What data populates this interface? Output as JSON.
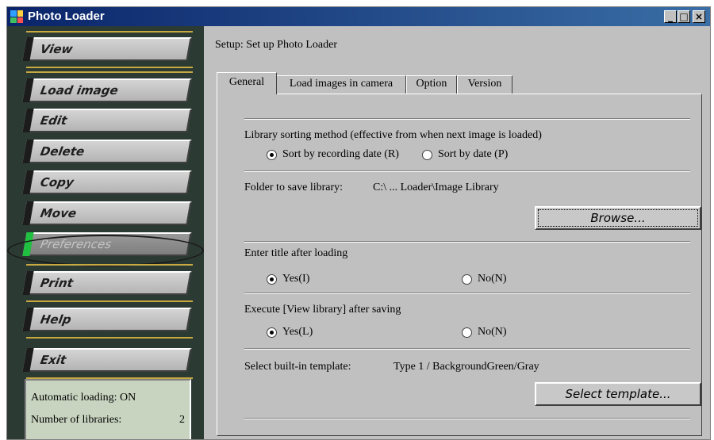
{
  "window": {
    "title": "Photo Loader",
    "min_glyph": "_",
    "max_glyph": "□",
    "close_glyph": "×"
  },
  "sidebar": {
    "buttons": [
      {
        "label": "View"
      },
      {
        "label": "Load image"
      },
      {
        "label": "Edit"
      },
      {
        "label": "Delete"
      },
      {
        "label": "Copy"
      },
      {
        "label": "Move"
      },
      {
        "label": "Preferences",
        "state": "selected"
      },
      {
        "label": "Print"
      },
      {
        "label": "Help"
      },
      {
        "label": "Exit"
      }
    ],
    "status": {
      "auto_loading": "Automatic loading:  ON",
      "libraries_label": "Number of libraries:",
      "libraries_value": "2"
    }
  },
  "content": {
    "header": "Setup: Set up Photo Loader",
    "tabs": [
      {
        "label": "General",
        "active": true
      },
      {
        "label": "Load images in camera"
      },
      {
        "label": "Option"
      },
      {
        "label": "Version"
      }
    ],
    "sorting": {
      "label": "Library sorting method (effective from when next image is loaded)",
      "opt1": "Sort by recording date (R)",
      "opt2": "Sort by date (P)",
      "selected": "opt1"
    },
    "folder": {
      "label": "Folder to save library:",
      "value": "C:\\ ... Loader\\Image Library",
      "browse_label": "Browse..."
    },
    "enter_title": {
      "label": "Enter title after loading",
      "yes": "Yes(I)",
      "no": "No(N)",
      "selected": "yes"
    },
    "exec_view": {
      "label": "Execute [View library] after saving",
      "yes": "Yes(L)",
      "no": "No(N)",
      "selected": "yes"
    },
    "template": {
      "label": "Select built-in template:",
      "value": "Type 1 / BackgroundGreen/Gray",
      "button_label": "Select template..."
    }
  },
  "colors": {
    "titlebar": "#0a246a",
    "sidebar": "#2c3a34",
    "separator": "#c8a840",
    "selected_marker": "#20c040",
    "status_bg": "#c8d4c0"
  }
}
